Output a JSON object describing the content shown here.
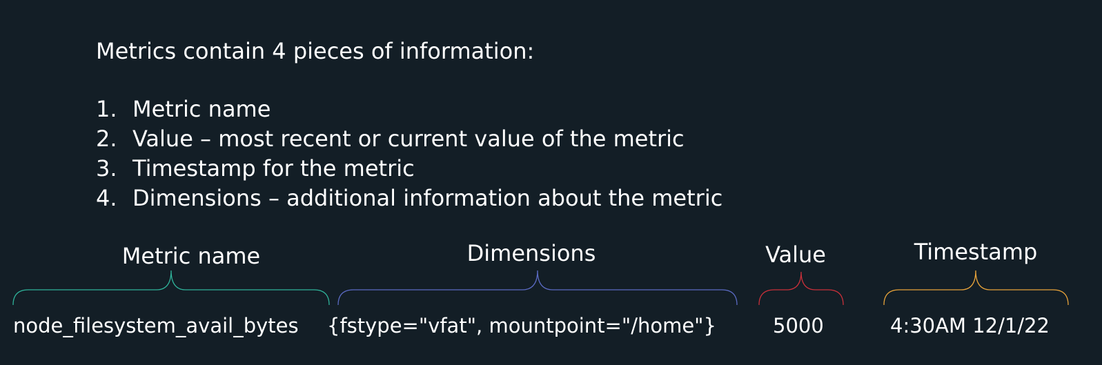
{
  "heading": "Metrics contain 4 pieces of information:",
  "points": [
    {
      "num": "1.",
      "text": "Metric name"
    },
    {
      "num": "2.",
      "text": "Value – most recent or current value of the metric"
    },
    {
      "num": "3.",
      "text": "Timestamp for the metric"
    },
    {
      "num": "4.",
      "text": "Dimensions – additional information about the metric"
    }
  ],
  "segments": {
    "name": {
      "label": "Metric name",
      "text": "node_filesystem_avail_bytes",
      "color": "#2fb39a"
    },
    "dimensions": {
      "label": "Dimensions",
      "text": "{fstype=\"vfat\", mountpoint=\"/home\"}",
      "color": "#5b6bc4"
    },
    "value": {
      "label": "Value",
      "text": "5000",
      "color": "#c9303a"
    },
    "timestamp": {
      "label": "Timestamp",
      "text": "4:30AM 12/1/22",
      "color": "#e8a33a"
    }
  }
}
